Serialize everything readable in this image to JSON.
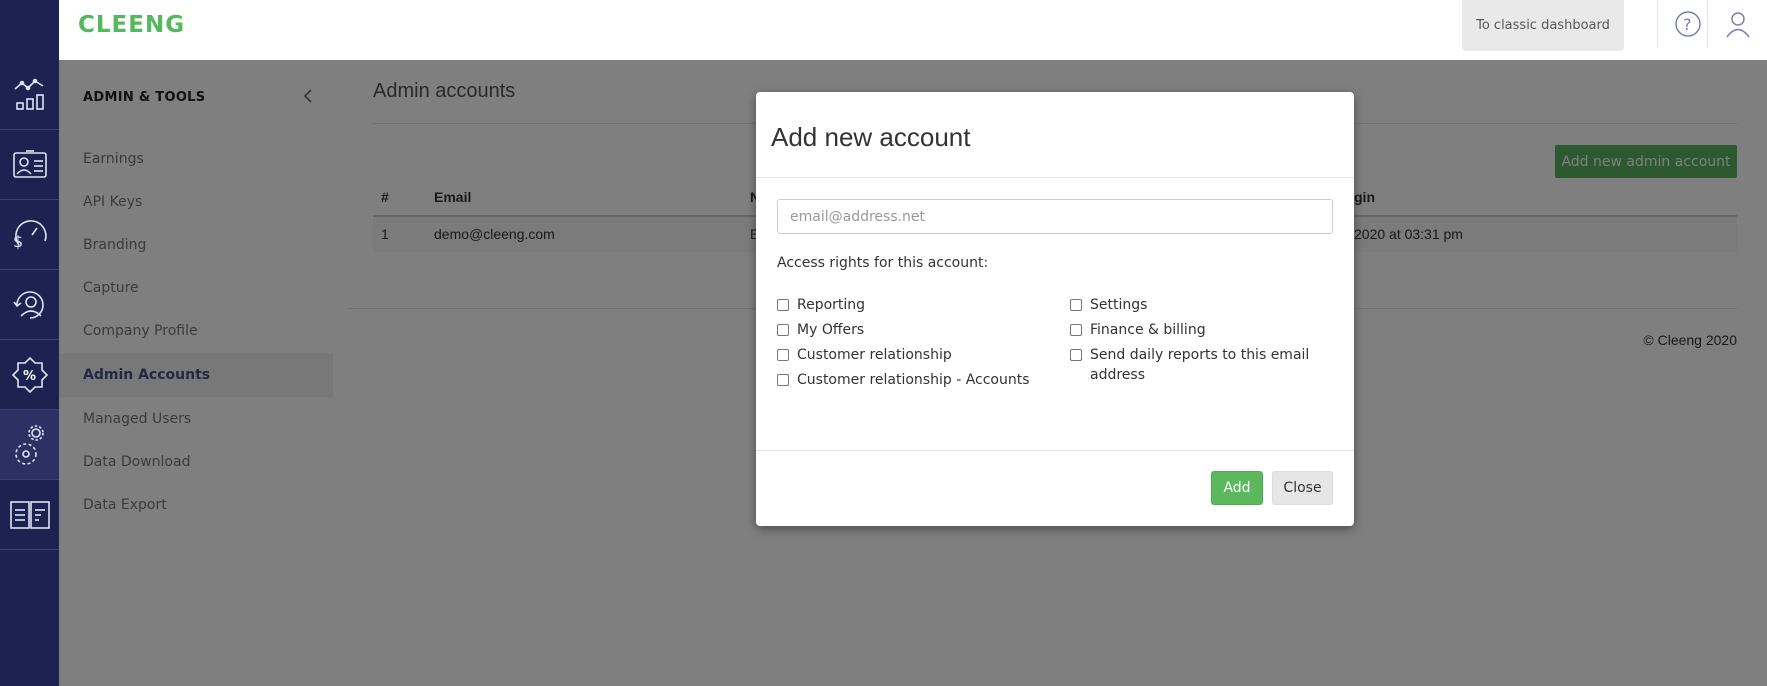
{
  "app": {
    "logo": "CLEENG"
  },
  "topbar": {
    "classic_label": "To classic dashboard",
    "help_icon": "question-circle-icon",
    "user_icon": "user-icon"
  },
  "rail": {
    "items": [
      {
        "icon": "analytics-icon"
      },
      {
        "icon": "customer-card-icon"
      },
      {
        "icon": "revenue-gauge-icon"
      },
      {
        "icon": "customer-cycle-icon"
      },
      {
        "icon": "discount-badge-icon"
      },
      {
        "icon": "settings-gears-icon",
        "active": true
      },
      {
        "icon": "book-icon"
      }
    ]
  },
  "sidebar": {
    "title": "ADMIN & TOOLS",
    "items": [
      {
        "label": "Earnings"
      },
      {
        "label": "API Keys"
      },
      {
        "label": "Branding"
      },
      {
        "label": "Capture"
      },
      {
        "label": "Company Profile"
      },
      {
        "label": "Admin Accounts",
        "active": true
      },
      {
        "label": "Managed Users"
      },
      {
        "label": "Data Download"
      },
      {
        "label": "Data Export"
      }
    ]
  },
  "main": {
    "title": "Admin accounts",
    "add_button": "Add new admin account",
    "table": {
      "headers": {
        "num": "#",
        "email": "Email",
        "third": "N",
        "last_login": "gin"
      },
      "rows": [
        {
          "num": "1",
          "email": "demo@cleeng.com",
          "third": "E",
          "last_login": "2020 at 03:31 pm"
        }
      ]
    },
    "copyright": "© Cleeng 2020"
  },
  "modal": {
    "title": "Add new account",
    "email_placeholder": "email@address.net",
    "email_value": "",
    "rights_label": "Access rights for this account:",
    "left_checkboxes": [
      {
        "label": "Reporting",
        "checked": false
      },
      {
        "label": "My Offers",
        "checked": false
      },
      {
        "label": "Customer relationship",
        "checked": false
      },
      {
        "label": "Customer relationship - Accounts",
        "checked": false
      }
    ],
    "right_checkboxes": [
      {
        "label": "Settings",
        "checked": false
      },
      {
        "label": "Finance & billing",
        "checked": false
      },
      {
        "label": "Send daily reports to this email address",
        "checked": false
      }
    ],
    "add_label": "Add",
    "close_label": "Close"
  },
  "colors": {
    "rail_bg": "#1d2350",
    "brand_green": "#56b85e",
    "active_nav": "#4b4f8c",
    "add_button": "#5cb85c"
  }
}
